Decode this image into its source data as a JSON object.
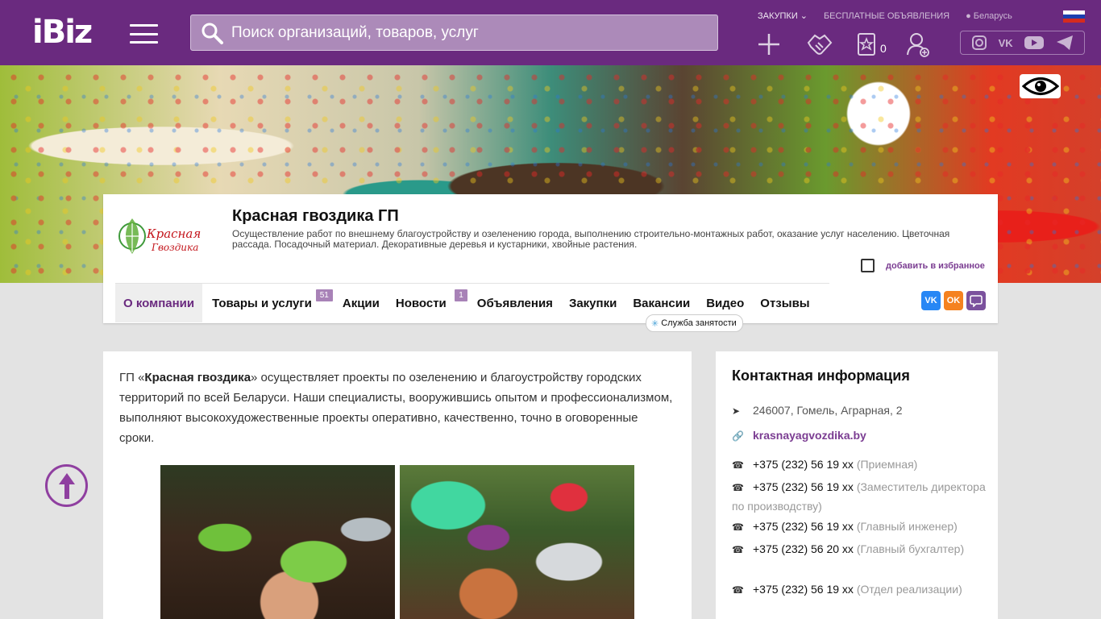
{
  "header": {
    "logo": "iBiz",
    "search_placeholder": "Поиск организаций, товаров, услуг",
    "links": [
      "ЗАКУПКИ",
      "БЕСПЛАТНЫЕ ОБЪЯВЛЕНИЯ",
      "Беларусь"
    ],
    "favorites_count": "0",
    "colors": {
      "bar": "#6a2a7f"
    }
  },
  "company": {
    "name": "Красная гвоздика ГП",
    "description": "Осуществление работ по внешнему благоустройству и озеленению города, выполнению строительно-монтажных работ, оказание услуг населению. Цветочная рассада. Посадочный материал. Декоративные деревья и кустарники, хвойные растения.",
    "logo_line1": "Красная",
    "logo_line2": "Гвоздика",
    "add_favorite": "добавить в избранное"
  },
  "tabs": [
    {
      "label": "О компании"
    },
    {
      "label": "Товары и услуги",
      "badge": "51"
    },
    {
      "label": "Акции"
    },
    {
      "label": "Новости",
      "badge": "1"
    },
    {
      "label": "Объявления"
    },
    {
      "label": "Закупки"
    },
    {
      "label": "Вакансии"
    },
    {
      "label": "Видео"
    },
    {
      "label": "Отзывы"
    }
  ],
  "tooltip": "Служба занятости",
  "share": [
    "vk",
    "ok",
    "viber"
  ],
  "about": {
    "prefix": "ГП «",
    "name_bold": "Красная гвоздика",
    "text": "» осуществляет проекты по озеленению и благоустройству городских территорий по всей Беларуси. Наши специалисты, вооружившись опытом и профессионализмом, выполняют высокохудожественные проекты оперативно, качественно, точно в оговоренные сроки."
  },
  "contacts": {
    "title": "Контактная информация",
    "address": "246007, Гомель, Аграрная, 2",
    "site": "krasnayagvozdika.by",
    "phones": [
      {
        "number": "+375 (232) 56 19 xx",
        "note": "(Приемная)"
      },
      {
        "number": "+375 (232) 56 19 xx",
        "note": "(Заместитель директора по производству)"
      },
      {
        "number": "+375 (232) 56 19 xx",
        "note": "(Главный инженер)"
      },
      {
        "number": "+375 (232) 56 20 xx",
        "note": "(Главный бухгалтер)"
      },
      {
        "number": "+375 (232) 56 19 xx",
        "note": "(Отдел реализации)"
      }
    ]
  }
}
